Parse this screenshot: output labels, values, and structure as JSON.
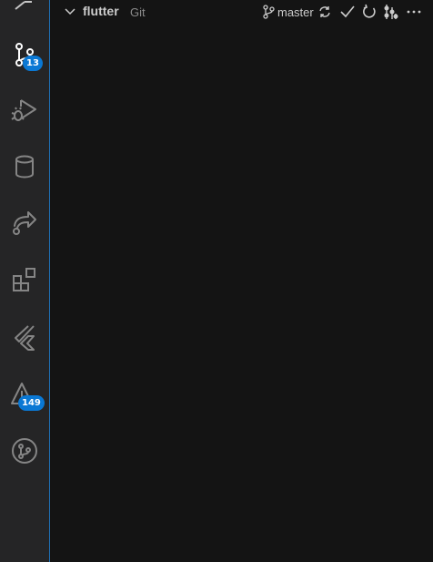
{
  "activity_bar": {
    "source_control_badge": "13",
    "problems_badge": "149",
    "accent_color": "#1e6fb4",
    "badge_color": "#0a78d4"
  },
  "scm": {
    "repo_name": "flutter",
    "repo_type": "Git",
    "branch": "master"
  }
}
